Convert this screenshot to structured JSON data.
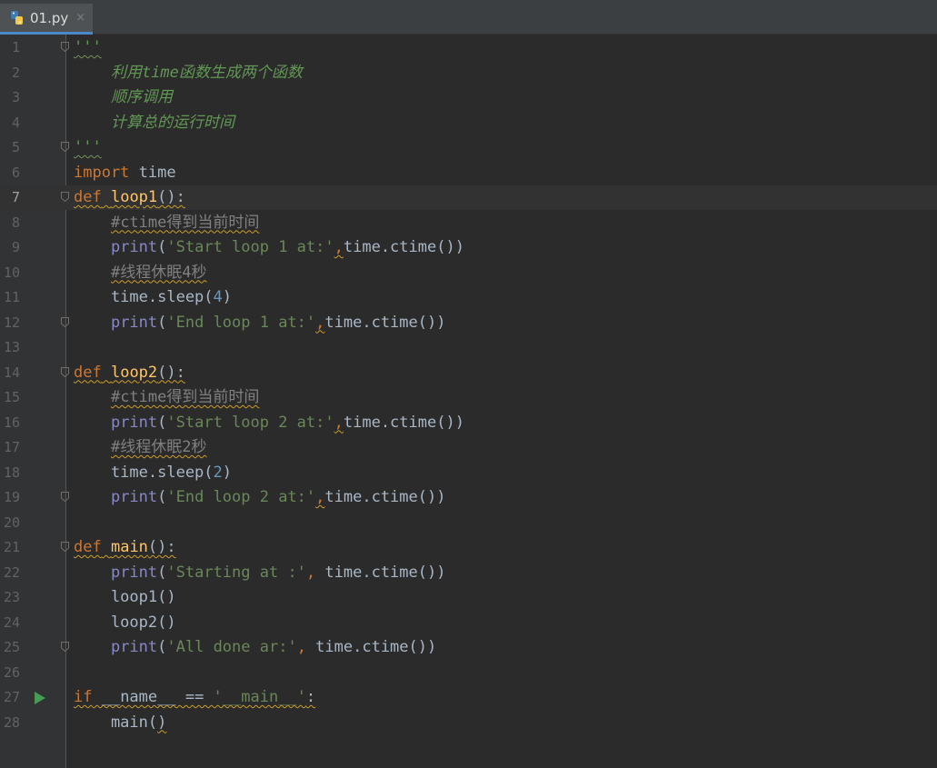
{
  "tab": {
    "label": "01.py",
    "close": "×",
    "icon": "python-file-icon"
  },
  "colors": {
    "keyword": "#cc7832",
    "function": "#ffc66d",
    "string": "#6a8759",
    "docstring": "#629755",
    "comment": "#808080",
    "number": "#6897bb",
    "builtin": "#8888c6",
    "default": "#a9b7c6",
    "run": "#499c54"
  },
  "editor": {
    "current_line": 7,
    "lines": [
      {
        "n": "1",
        "fold": true,
        "tokens": [
          [
            "doc sq-g",
            "'''"
          ]
        ]
      },
      {
        "n": "2",
        "tokens": [
          [
            "doc",
            "    利用time函数生成两个函数"
          ]
        ]
      },
      {
        "n": "3",
        "tokens": [
          [
            "doc",
            "    顺序调用"
          ]
        ]
      },
      {
        "n": "4",
        "tokens": [
          [
            "doc",
            "    计算总的运行时间"
          ]
        ]
      },
      {
        "n": "5",
        "fold": true,
        "tokens": [
          [
            "doc sq-g",
            "'''"
          ]
        ]
      },
      {
        "n": "6",
        "tokens": [
          [
            "kw",
            "import"
          ],
          [
            "",
            " time"
          ]
        ]
      },
      {
        "n": "7",
        "fold": true,
        "tokens": [
          [
            "kw sq",
            "def"
          ],
          [
            "sq",
            " "
          ],
          [
            "fn sq",
            "loop1"
          ],
          [
            "sq",
            "():"
          ]
        ]
      },
      {
        "n": "8",
        "tokens": [
          [
            "",
            "    "
          ],
          [
            "cmt sq",
            "#ctime得到当前时间"
          ]
        ]
      },
      {
        "n": "9",
        "tokens": [
          [
            "",
            "    "
          ],
          [
            "bi",
            "print"
          ],
          [
            "",
            "("
          ],
          [
            "str",
            "'Start loop 1 at:'"
          ],
          [
            "kw sq",
            ","
          ],
          [
            "",
            "time.ctime())"
          ]
        ]
      },
      {
        "n": "10",
        "tokens": [
          [
            "",
            "    "
          ],
          [
            "cmt sq",
            "#线程休眠4秒"
          ]
        ]
      },
      {
        "n": "11",
        "tokens": [
          [
            "",
            "    time.sleep("
          ],
          [
            "num",
            "4"
          ],
          [
            "",
            ")"
          ]
        ]
      },
      {
        "n": "12",
        "fold": true,
        "tokens": [
          [
            "",
            "    "
          ],
          [
            "bi",
            "print"
          ],
          [
            "",
            "("
          ],
          [
            "str",
            "'End loop 1 at:'"
          ],
          [
            "kw sq",
            ","
          ],
          [
            "",
            "time.ctime())"
          ]
        ]
      },
      {
        "n": "13",
        "tokens": []
      },
      {
        "n": "14",
        "fold": true,
        "tokens": [
          [
            "kw sq",
            "def"
          ],
          [
            "sq",
            " "
          ],
          [
            "fn sq",
            "loop2"
          ],
          [
            "sq",
            "():"
          ]
        ]
      },
      {
        "n": "15",
        "tokens": [
          [
            "",
            "    "
          ],
          [
            "cmt sq",
            "#ctime得到当前时间"
          ]
        ]
      },
      {
        "n": "16",
        "tokens": [
          [
            "",
            "    "
          ],
          [
            "bi",
            "print"
          ],
          [
            "",
            "("
          ],
          [
            "str",
            "'Start loop 2 at:'"
          ],
          [
            "kw sq",
            ","
          ],
          [
            "",
            "time.ctime())"
          ]
        ]
      },
      {
        "n": "17",
        "tokens": [
          [
            "",
            "    "
          ],
          [
            "cmt sq",
            "#线程休眠2秒"
          ]
        ]
      },
      {
        "n": "18",
        "tokens": [
          [
            "",
            "    time.sleep("
          ],
          [
            "num",
            "2"
          ],
          [
            "",
            ")"
          ]
        ]
      },
      {
        "n": "19",
        "fold": true,
        "tokens": [
          [
            "",
            "    "
          ],
          [
            "bi",
            "print"
          ],
          [
            "",
            "("
          ],
          [
            "str",
            "'End loop 2 at:'"
          ],
          [
            "kw sq",
            ","
          ],
          [
            "",
            "time.ctime())"
          ]
        ]
      },
      {
        "n": "20",
        "tokens": []
      },
      {
        "n": "21",
        "fold": true,
        "tokens": [
          [
            "kw sq",
            "def"
          ],
          [
            "sq",
            " "
          ],
          [
            "fn sq",
            "main"
          ],
          [
            "sq",
            "():"
          ]
        ]
      },
      {
        "n": "22",
        "tokens": [
          [
            "",
            "    "
          ],
          [
            "bi",
            "print"
          ],
          [
            "",
            "("
          ],
          [
            "str",
            "'Starting at :'"
          ],
          [
            "kw",
            ","
          ],
          [
            "",
            " time.ctime())"
          ]
        ]
      },
      {
        "n": "23",
        "tokens": [
          [
            "",
            "    loop1()"
          ]
        ]
      },
      {
        "n": "24",
        "tokens": [
          [
            "",
            "    loop2()"
          ]
        ]
      },
      {
        "n": "25",
        "fold": true,
        "tokens": [
          [
            "",
            "    "
          ],
          [
            "bi",
            "print"
          ],
          [
            "",
            "("
          ],
          [
            "str",
            "'All done ar:'"
          ],
          [
            "kw",
            ","
          ],
          [
            "",
            " time.ctime())"
          ]
        ]
      },
      {
        "n": "26",
        "tokens": []
      },
      {
        "n": "27",
        "run": true,
        "tokens": [
          [
            "kw sq",
            "if"
          ],
          [
            "sq",
            " __name__ == "
          ],
          [
            "str sq",
            "'__main__'"
          ],
          [
            "sq",
            ":"
          ]
        ]
      },
      {
        "n": "28",
        "tokens": [
          [
            "",
            "    main("
          ],
          [
            "sq",
            ")"
          ]
        ]
      }
    ]
  }
}
